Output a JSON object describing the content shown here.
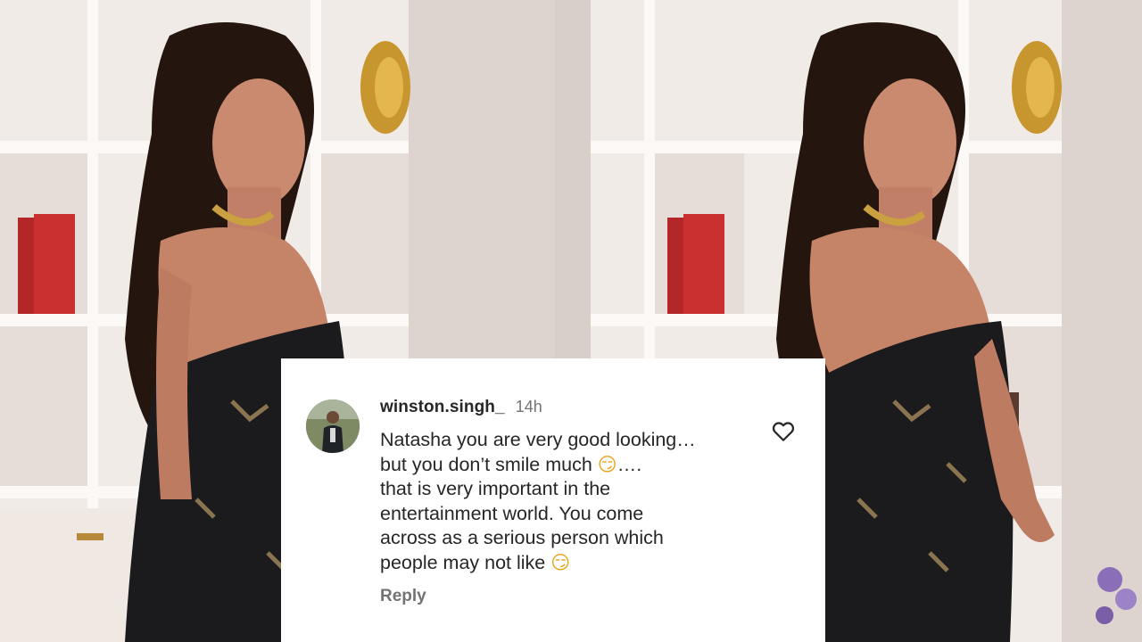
{
  "photos": {
    "left": {
      "description_icon": "portrait-photo"
    },
    "right": {
      "description_icon": "portrait-photo"
    }
  },
  "comment": {
    "username": "winston.singh_",
    "timestamp": "14h",
    "lines": [
      "Natasha you are very good looking…",
      "but you don’t smile much",
      "that is very important in the",
      "entertainment world. You come",
      "across as a serious person which",
      "people may not like"
    ],
    "line2_suffix": "….",
    "emoji": "😏",
    "reply_label": "Reply",
    "like_icon": "heart-outline-icon"
  },
  "colors": {
    "card_bg": "#ffffff",
    "username": "#262626",
    "meta": "#737373",
    "emoji": "#e8a21a"
  }
}
